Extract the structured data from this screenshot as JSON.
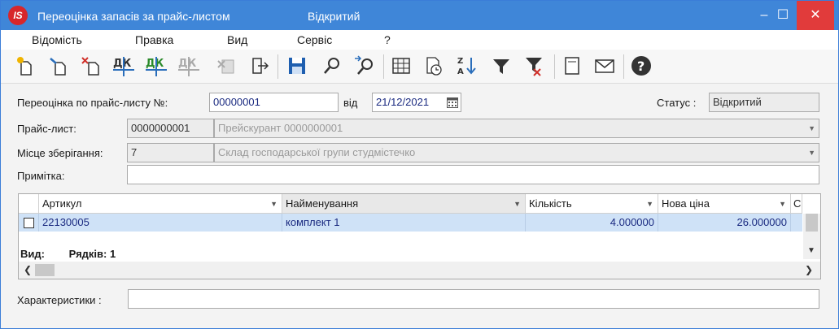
{
  "window": {
    "app_logo": "IS",
    "title": "Переоцінка запасів за прайс-листом",
    "status": "Відкритий",
    "controls": {
      "minimize": "–",
      "maximize": "☐",
      "close": "✕"
    }
  },
  "menu": [
    "Відомість",
    "Правка",
    "Вид",
    "Сервіс",
    "?"
  ],
  "toolbar": {
    "icons": [
      "new-icon",
      "copy-icon",
      "delete-icon",
      "debit-credit-icon",
      "debit-credit-green-icon",
      "debit-credit-disabled-icon",
      "cross-disabled-icon",
      "exit-icon",
      "save-icon",
      "search-icon",
      "search-next-icon",
      "table-icon",
      "history-icon",
      "sort-icon",
      "filter-icon",
      "filter-clear-icon",
      "note-icon",
      "mail-icon",
      "help-icon"
    ],
    "dk_text": "ДК"
  },
  "form": {
    "doc_label": "Переоцінка по прайс-листу №:",
    "doc_number": "00000001",
    "date_label": "від",
    "date_value": "21/12/2021",
    "status_label": "Статус :",
    "status_value": "Відкритий",
    "pricelist_label": "Прайс-лист:",
    "pricelist_code": "0000000001",
    "pricelist_name": "Прейскурант 0000000001",
    "storage_label": "Місце зберігання:",
    "storage_code": "7",
    "storage_name": "Склад господарської групи студмістечко",
    "note_label": "Примітка:",
    "note_value": ""
  },
  "grid": {
    "columns": [
      "Артикул",
      "Найменування",
      "Кількість",
      "Нова ціна",
      "С"
    ],
    "rows": [
      {
        "article": "22130005",
        "name": "комплект 1",
        "quantity": "4.000000",
        "new_price": "26.000000"
      }
    ],
    "view_label": "Вид:",
    "rows_label": "Рядків: 1"
  },
  "characteristics_label": "Характеристики :",
  "characteristics_value": "",
  "colors": {
    "titlebar": "#3f86d8",
    "close": "#e13b3b",
    "selected_row": "#cfe2f7",
    "value_text": "#1a2a80"
  }
}
